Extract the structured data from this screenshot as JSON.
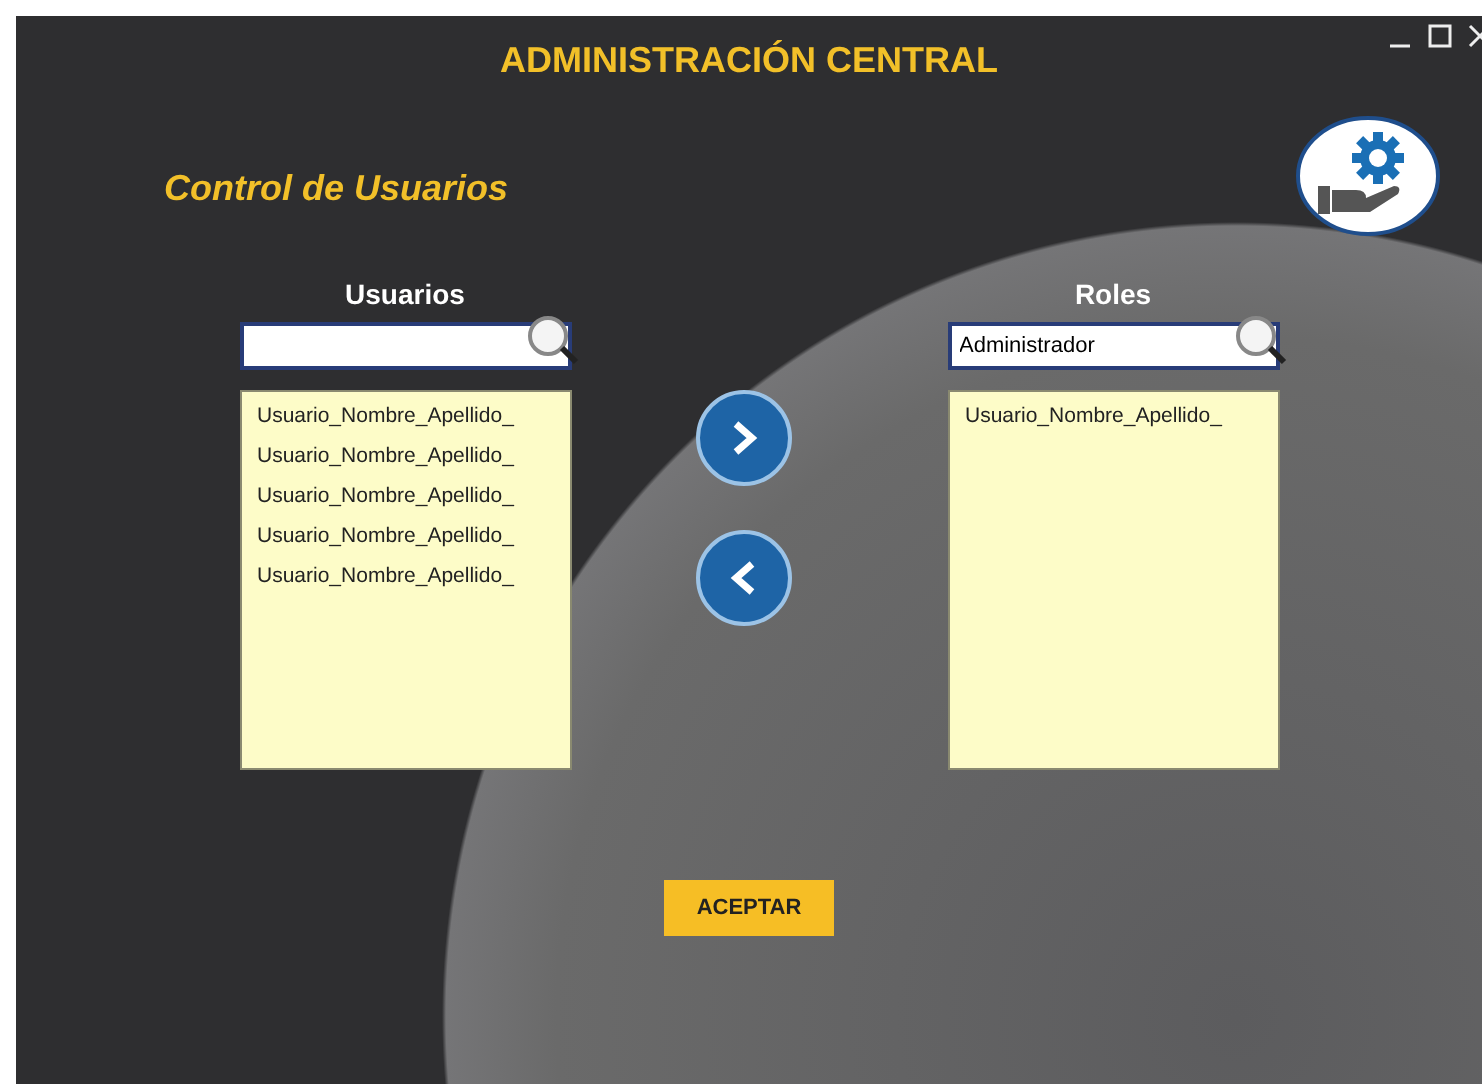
{
  "window": {
    "title": "ADMINISTRACIÓN CENTRAL"
  },
  "section_title": "Control de Usuarios",
  "users_panel": {
    "label": "Usuarios",
    "items": [
      "Usuario_Nombre_Apellido_",
      "Usuario_Nombre_Apellido_",
      "Usuario_Nombre_Apellido_",
      "Usuario_Nombre_Apellido_",
      "Usuario_Nombre_Apellido_"
    ]
  },
  "roles_panel": {
    "label": "Roles",
    "search": {
      "value": "Administrador"
    },
    "items": [
      "Usuario_Nombre_Apellido_"
    ]
  },
  "accept_button": "ACEPTAR"
}
